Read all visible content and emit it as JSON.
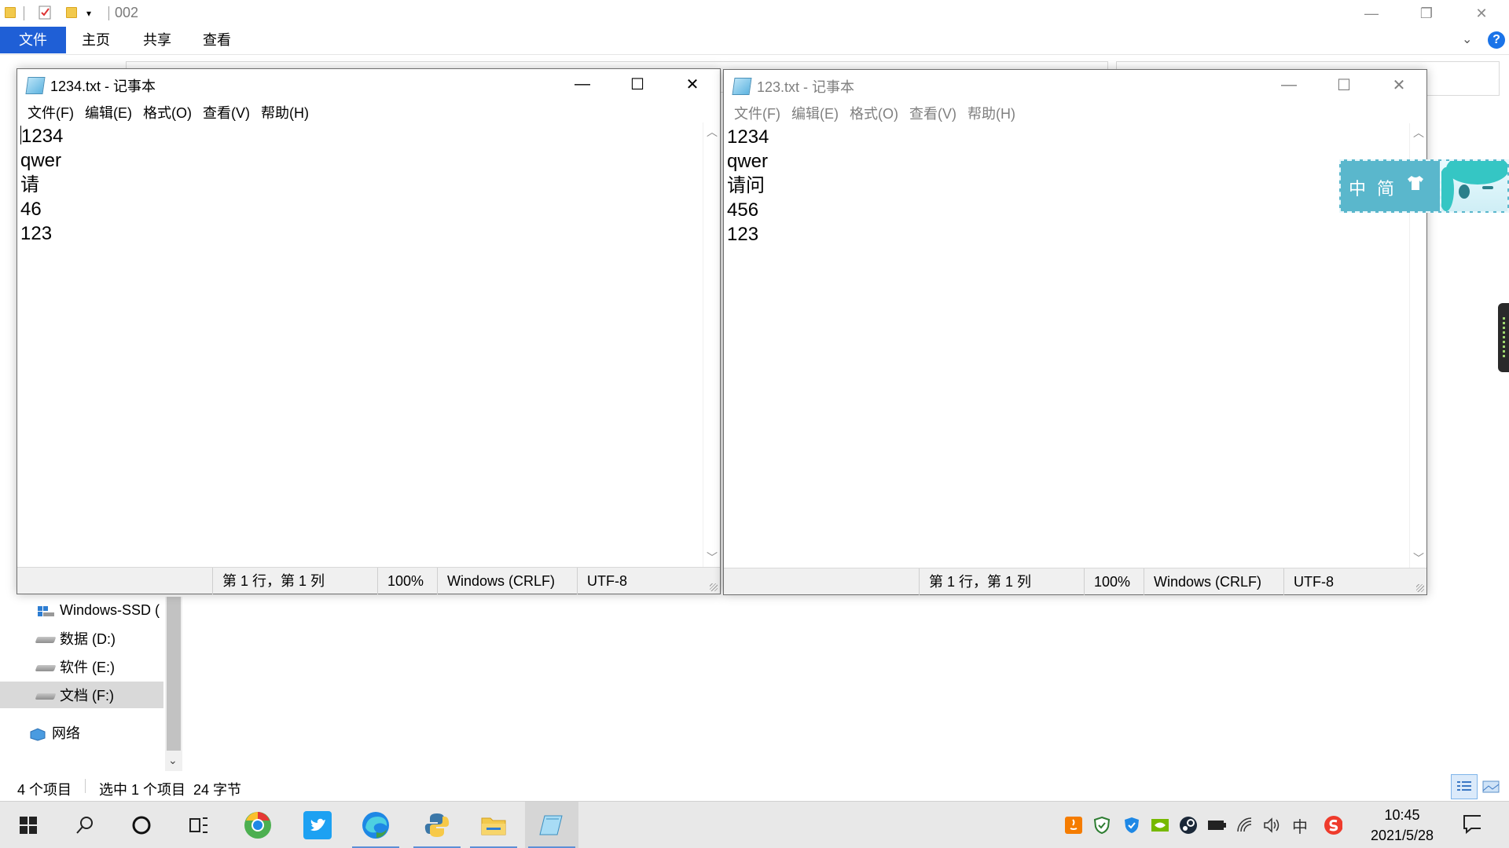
{
  "explorer": {
    "title": "002",
    "ribbon_tabs": [
      "文件",
      "主页",
      "共享",
      "查看"
    ],
    "nav_items": [
      {
        "label": "Windows-SSD (",
        "icon": "ssd-drive-icon"
      },
      {
        "label": "数据 (D:)",
        "icon": "drive-icon"
      },
      {
        "label": "软件 (E:)",
        "icon": "drive-icon"
      },
      {
        "label": "文档 (F:)",
        "icon": "drive-icon",
        "selected": true
      },
      {
        "label": "网络",
        "icon": "network-icon"
      }
    ],
    "status": {
      "item_count": "4 个项目",
      "selection": "选中 1 个项目",
      "size": "24 字节"
    },
    "help_glyph": "?"
  },
  "notepad_left": {
    "title": "1234.txt - 记事本",
    "menu": [
      "文件(F)",
      "编辑(E)",
      "格式(O)",
      "查看(V)",
      "帮助(H)"
    ],
    "lines": [
      "1234",
      "qwer",
      "请",
      "46",
      "123"
    ],
    "status": {
      "position": "第 1 行，第 1 列",
      "zoom": "100%",
      "line_ending": "Windows (CRLF)",
      "encoding": "UTF-8"
    },
    "active": true
  },
  "notepad_right": {
    "title": "123.txt - 记事本",
    "menu": [
      "文件(F)",
      "编辑(E)",
      "格式(O)",
      "查看(V)",
      "帮助(H)"
    ],
    "lines": [
      "1234",
      "qwer",
      "请问",
      "456",
      "123"
    ],
    "status": {
      "position": "第 1 行，第 1 列",
      "zoom": "100%",
      "line_ending": "Windows (CRLF)",
      "encoding": "UTF-8"
    },
    "active": false
  },
  "ime_bar": {
    "chinese_mode": "中",
    "simplified": "简",
    "skin_icon": "tshirt-icon"
  },
  "taskbar": {
    "pinned": [
      "windows-start-icon",
      "search-icon",
      "cortana-icon",
      "task-view-icon",
      "chrome-icon",
      "twitter-icon",
      "edge-icon",
      "python-icon",
      "file-explorer-icon",
      "notepad-icon"
    ],
    "tray_input_lang": "中",
    "clock_time": "10:45",
    "clock_date": "2021/5/28"
  },
  "colors": {
    "ribbon_file_tab": "#1f5fd6",
    "ime_bar": "#5ab7cc",
    "taskbar": "#e8e8e8",
    "active_indicator": "#5d8fd6"
  }
}
